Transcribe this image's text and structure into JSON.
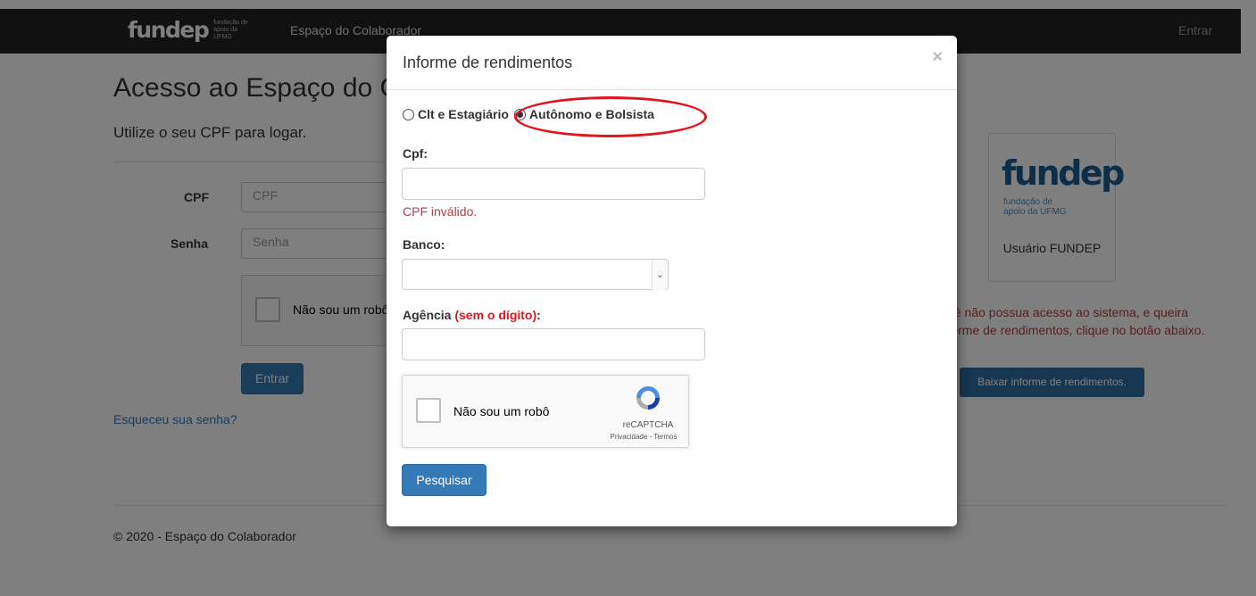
{
  "navbar": {
    "brand": "fundep",
    "brand_sub": "fundação de apoio da UFMG",
    "link": "Espaço do Colaborador",
    "login": "Entrar"
  },
  "page": {
    "title": "Acesso ao Espaço do Colaborador",
    "subtitle": "Utilize o seu CPF para logar.",
    "cpf_label": "CPF",
    "cpf_placeholder": "CPF",
    "password_label": "Senha",
    "password_placeholder": "Senha",
    "captcha_text": "Não sou um robô",
    "enter_button": "Entrar",
    "forgot_link": "Esqueceu sua senha?",
    "footer": "© 2020 - Espaço do Colaborador"
  },
  "side": {
    "logo_word": "fundep",
    "logo_sub": "fundação de apoio da UFMG",
    "card_caption": "Usuário FUNDEP",
    "message": "ê não possua acesso ao sistema, e queira informe de rendimentos, clique no botão abaixo.",
    "download_button": "Baixar informe de rendimentos."
  },
  "modal": {
    "title": "Informe de rendimentos",
    "close": "×",
    "radio_clt": "Clt e Estagiário",
    "radio_autonomo": "Autônomo e Bolsista",
    "selected_radio": "Autônomo e Bolsista",
    "cpf_label": "Cpf:",
    "cpf_value": "",
    "cpf_error": "CPF inválido.",
    "bank_label": "Banco:",
    "bank_value": "",
    "agency_label": "Agência",
    "agency_note": "(sem o dígito)",
    "agency_colon": ":",
    "agency_value": "",
    "captcha_text": "Não sou um robô",
    "captcha_brand": "reCAPTCHA",
    "captcha_links": "Privacidade - Termos",
    "search_button": "Pesquisar"
  },
  "colors": {
    "primary": "#337ab7",
    "error": "#a94442",
    "highlight": "#e0161c",
    "navbar": "#222222"
  }
}
